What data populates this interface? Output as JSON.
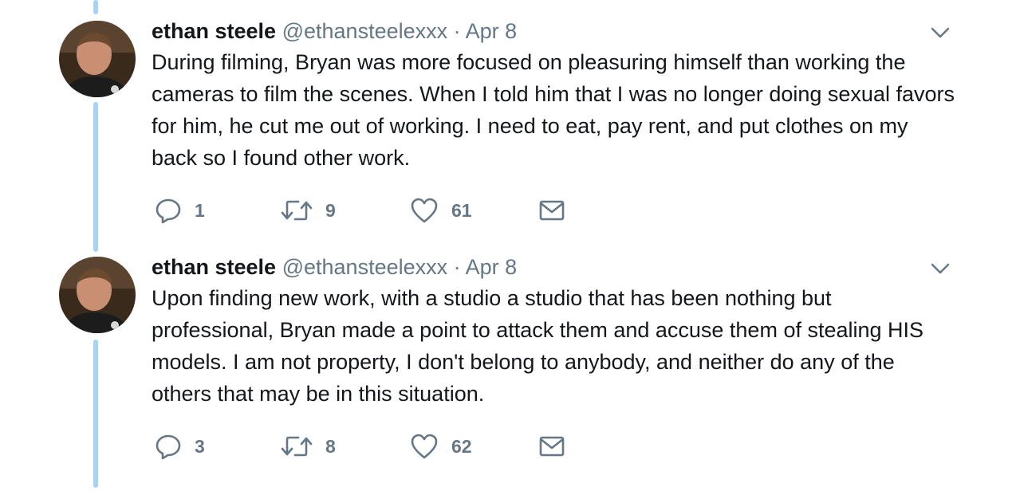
{
  "tweets": [
    {
      "name": "ethan steele",
      "handle": "@ethansteelexxx",
      "separator": "·",
      "date": "Apr 8",
      "text": "During filming, Bryan was more focused on pleasuring himself than working the cameras to film the scenes. When I told him that I was no longer doing sexual favors for him, he cut me out of working. I need to eat, pay rent, and put clothes on my back so I found other work.",
      "replies": "1",
      "retweets": "9",
      "likes": "61"
    },
    {
      "name": "ethan steele",
      "handle": "@ethansteelexxx",
      "separator": "·",
      "date": "Apr 8",
      "text": "Upon finding new work, with a studio a studio that has been nothing but professional, Bryan made a point to attack them and accuse them of stealing HIS models. I am not property, I don't belong to anybody, and neither do any of the others that may be in this situation.",
      "replies": "3",
      "retweets": "8",
      "likes": "62"
    }
  ],
  "icons": {
    "reply": "reply-icon",
    "retweet": "retweet-icon",
    "like": "heart-icon",
    "dm": "envelope-icon",
    "more": "chevron-down-icon"
  },
  "colors": {
    "thread_line": "#a6d2f5",
    "secondary_text": "#657786",
    "primary_text": "#14171a"
  }
}
